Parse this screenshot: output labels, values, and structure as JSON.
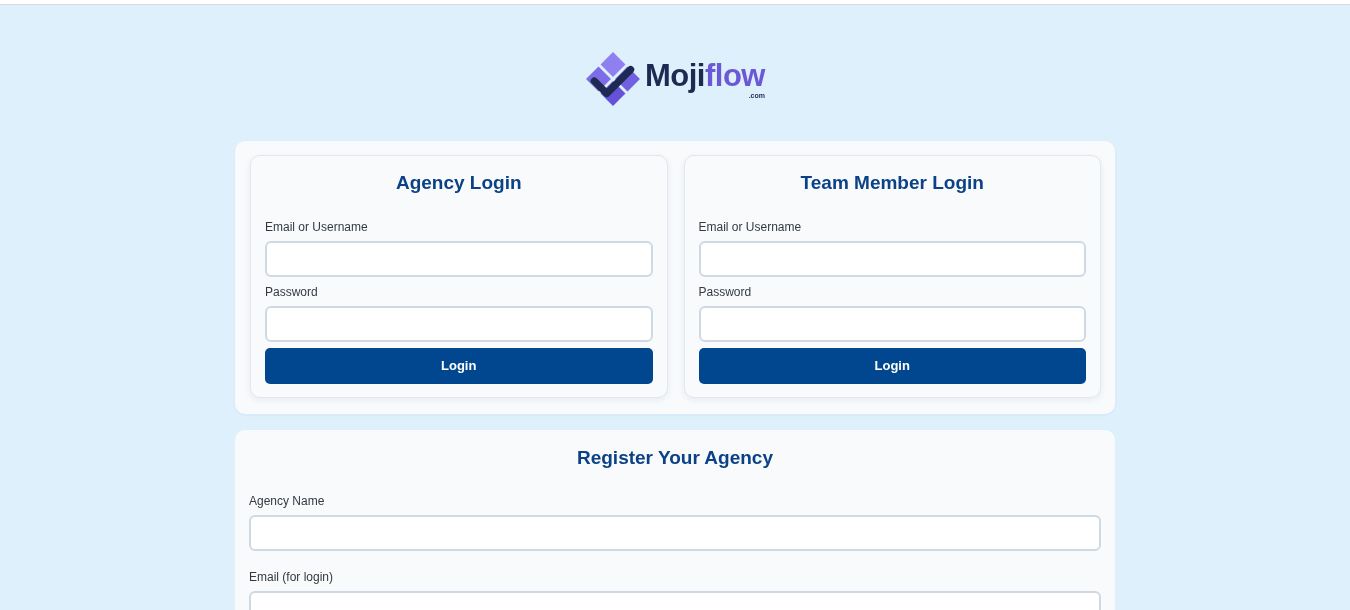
{
  "logo": {
    "name_part": "Moji",
    "accent_part": "flow",
    "domain": ".com"
  },
  "login_panels": [
    {
      "title": "Agency Login",
      "fields": [
        {
          "label": "Email or Username"
        },
        {
          "label": "Password"
        }
      ],
      "button": "Login"
    },
    {
      "title": "Team Member Login",
      "fields": [
        {
          "label": "Email or Username"
        },
        {
          "label": "Password"
        }
      ],
      "button": "Login"
    }
  ],
  "register": {
    "title": "Register Your Agency",
    "fields": [
      {
        "label": "Agency Name"
      },
      {
        "label": "Email (for login)"
      }
    ]
  }
}
